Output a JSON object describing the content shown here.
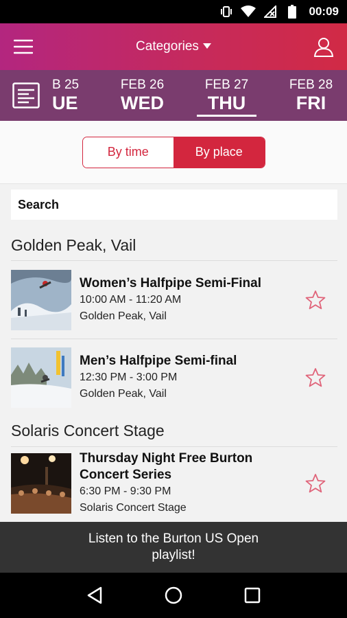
{
  "status": {
    "time": "00:09",
    "icons": [
      "vibrate-icon",
      "wifi-icon",
      "no-signal-icon",
      "battery-icon"
    ]
  },
  "appbar": {
    "title": "Categories",
    "menu_icon": "hamburger-menu-icon",
    "profile_icon": "user-profile-icon"
  },
  "dates": [
    {
      "day": "B 25",
      "weekday": "UE",
      "active": false
    },
    {
      "day": "FEB 26",
      "weekday": "WED",
      "active": false
    },
    {
      "day": "FEB 27",
      "weekday": "THU",
      "active": true
    },
    {
      "day": "FEB 28",
      "weekday": "FRI",
      "active": false
    }
  ],
  "toggle": {
    "by_time": "By time",
    "by_place": "By place",
    "selected": "By place"
  },
  "search": {
    "placeholder": "Search"
  },
  "sections": [
    {
      "title": "Golden Peak, Vail",
      "events": [
        {
          "title": "Women’s Halfpipe Semi-Final",
          "time": "10:00 AM - 11:20 AM",
          "place": "Golden Peak, Vail"
        },
        {
          "title": "Men’s Halfpipe Semi-final",
          "time": "12:30 PM - 3:00 PM",
          "place": "Golden Peak, Vail"
        }
      ]
    },
    {
      "title": "Solaris Concert Stage",
      "events": [
        {
          "title": "Thursday Night Free Burton Concert Series",
          "time": "6:30 PM - 9:30 PM",
          "place": "Solaris Concert Stage"
        }
      ]
    }
  ],
  "banner": {
    "text": "Listen to the Burton US Open playlist!"
  },
  "colors": {
    "accent": "#d3263e",
    "date_bar": "#7a3c6e",
    "appbar_start": "#b3267f",
    "appbar_end": "#d12a45",
    "star": "#e0647a"
  }
}
